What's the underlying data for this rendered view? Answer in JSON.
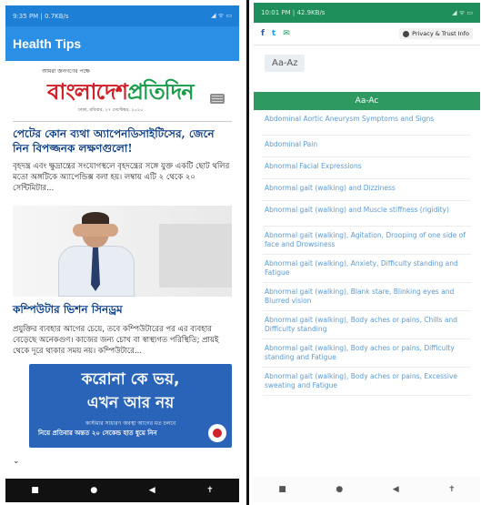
{
  "left": {
    "status": {
      "time": "9:35 PM | 0.7KB/s",
      "icons": "◢ ᯤ ▭"
    },
    "app_title": "Health Tips",
    "masthead": {
      "tagline": "আমরা জনগণের পক্ষে",
      "logo_part1": "বাংলাদেশ",
      "logo_part2": "প্রতিদিন",
      "date": "ঢাকা, রবিবার, ২৭ সেপ্টেম্বর, ২০২০"
    },
    "article1": {
      "headline": "পেটের কোন ব্যথা অ্যাপেনডিসাইটিসের, জেনে নিন বিপজ্জনক লক্ষণগুলো!",
      "summary": "বৃহদন্ত্র এবং ক্ষুদ্রান্ত্রের সংযোগস্থলে বৃহদন্ত্রের সঙ্গে যুক্ত একটি ছোট থলির মতো অঙ্গটিকে অ্যাপেন্ডিক্স বলা হয়। লম্বায় এটি ২ থেকে ২০ সেন্টিমিটার..."
    },
    "article2": {
      "headline": "কম্পিউটার ভিশন সিনড্রম",
      "summary": "প্রযুক্তির ব্যবহার আগের চেয়ে, তবে কম্পিউটারের পর এর ব্যবহার বেড়েছে অনেকগুণ। কাজের জন্য চোখ বা স্বাস্থ্যগত পরিস্থিতি; প্রায়ই থেকে দূরে থাকার সময় নয়। কম্পিউটারে..."
    },
    "ad": {
      "line1": "করোনা কে ভয়,",
      "line2": "এখন আর নয়",
      "line3": "কাস্টমার সাধারণ অবস্থা আগের মত চলবে",
      "line4": "নিয়ে প্রতিবার অন্তত ২০ সেকেন্ড হাত ধুয়ে নিন"
    },
    "nav": {
      "a": "■",
      "b": "●",
      "c": "◀",
      "d": "✝"
    }
  },
  "right": {
    "status": {
      "time": "10:01 PM | 42.9KB/s",
      "icons": "◢ ᯤ ▭"
    },
    "share": {
      "facebook": "f",
      "twitter": "t",
      "email": "✉"
    },
    "privacy_label": "Privacy & Trust Info",
    "az_label": "Aa-Az",
    "section_label": "Aa-Ac",
    "links": [
      "Abdominal Aortic Aneurysm Symptoms and Signs",
      "Abdominal Pain",
      "Abnormal Facial Expressions",
      "Abnormal gait (walking) and Dizziness",
      "Abnormal gait (walking) and Muscle stiffness (rigidity)",
      "Abnormal gait (walking), Agitation, Drooping of one side of face and Drowsiness",
      "Abnormal gait (walking), Anxiety, Difficulty standing and Fatigue",
      "Abnormal gait (walking), Blank stare, Blinking eyes and Blurred vision",
      "Abnormal gait (walking), Body aches or pains, Chills and Difficulty standing",
      "Abnormal gait (walking), Body aches or pains, Difficulty standing and Fatigue",
      "Abnormal gait (walking), Body aches or pains, Excessive sweating and Fatigue"
    ],
    "nav": {
      "a": "■",
      "b": "●",
      "c": "◀",
      "d": "✝"
    }
  },
  "colors": {
    "app_bar": "#2b8fe6",
    "headline": "#0c3f86",
    "logo_red": "#d21f27",
    "logo_green": "#1a9d4a",
    "section_green": "#2e9a62",
    "link_blue": "#5c9ad0"
  }
}
